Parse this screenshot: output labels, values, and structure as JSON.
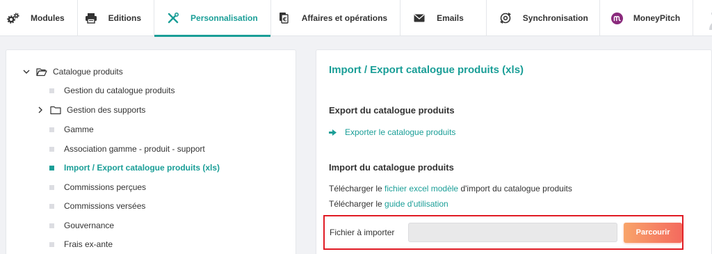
{
  "nav": {
    "tabs": [
      {
        "label": "Modules",
        "icon": "gears-icon"
      },
      {
        "label": "Editions",
        "icon": "printer-icon"
      },
      {
        "label": "Personnalisation",
        "icon": "tools-icon",
        "active": true
      },
      {
        "label": "Affaires et opérations",
        "icon": "documents-euro-icon"
      },
      {
        "label": "Emails",
        "icon": "envelope-icon"
      },
      {
        "label": "Synchronisation",
        "icon": "sync-icon"
      },
      {
        "label": "MoneyPitch",
        "icon": "moneypitch-logo-icon"
      }
    ]
  },
  "tree": {
    "root": "Catalogue produits",
    "items": [
      "Gestion du catalogue produits",
      "Gestion des supports",
      "Gamme",
      "Association gamme - produit - support",
      "Import / Export catalogue produits (xls)",
      "Commissions perçues",
      "Commissions versées",
      "Gouvernance",
      "Frais ex-ante"
    ]
  },
  "main": {
    "title": "Import / Export catalogue produits (xls)",
    "export_heading": "Export du catalogue produits",
    "export_link": "Exporter le catalogue produits",
    "import_heading": "Import du catalogue produits",
    "line1_prefix": "Télécharger le ",
    "line1_link": "fichier excel modèle",
    "line1_suffix": " d'import du catalogue produits",
    "line2_prefix": "Télécharger le ",
    "line2_link": "guide d'utilisation",
    "file_label": "Fichier à importer",
    "file_value": "",
    "browse_button": "Parcourir"
  },
  "colors": {
    "accent": "#1a9e97",
    "highlight": "#e01b24",
    "button": "#f46a5e"
  }
}
